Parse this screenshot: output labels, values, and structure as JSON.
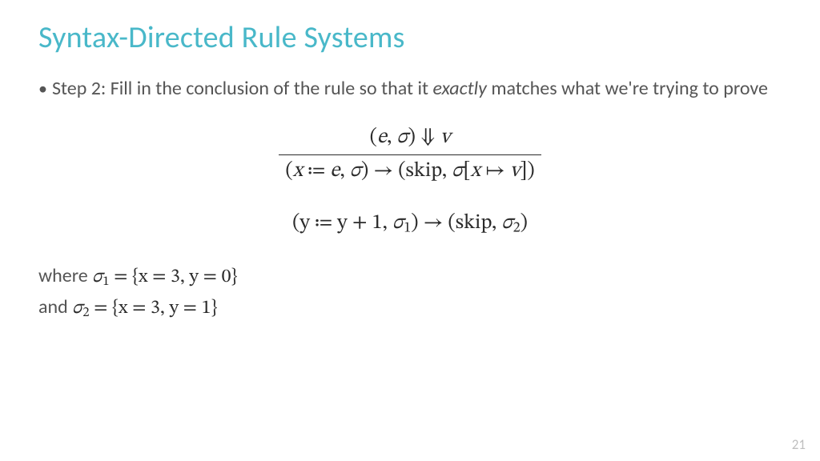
{
  "title": "Syntax-Directed Rule Systems",
  "bullet": {
    "lead": "Step 2: Fill in the conclusion of the rule so that it ",
    "emph": "exactly",
    "tail": " matches what we're trying to prove"
  },
  "inference": {
    "premise": "(𝑒, 𝜎) ⇓ 𝑣",
    "conclusion": "(𝑥 ≔ 𝑒, 𝜎) → (skip, 𝜎[𝑥 ↦ 𝑣])"
  },
  "step": "(y ≔ y + 1, 𝜎₁) → (skip, 𝜎₂)",
  "where": {
    "label1": "where ",
    "sigma1": "𝜎₁ = {x = 3, y = 0}",
    "label2": "and ",
    "sigma2": "𝜎₂ = {x = 3, y = 1}"
  },
  "page": "21"
}
